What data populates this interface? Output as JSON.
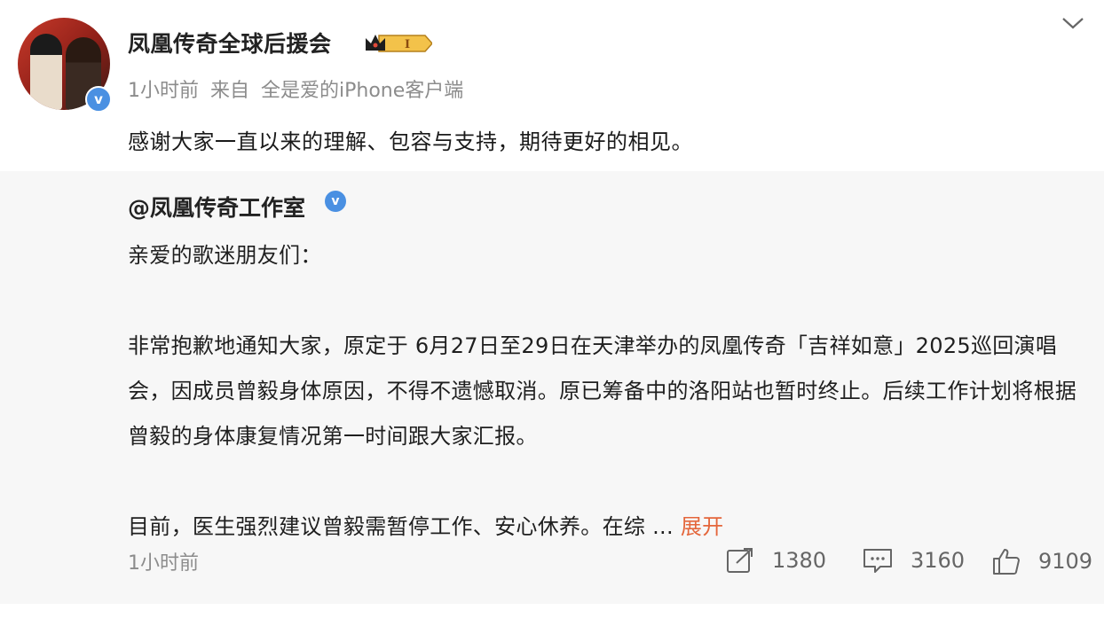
{
  "post": {
    "username": "凤凰传奇全球后援会",
    "level_badge": "I",
    "time": "1小时前",
    "source_prefix": "来自",
    "source": "全是爱的iPhone客户端",
    "content": "感谢大家一直以来的理解、包容与支持，期待更好的相见。"
  },
  "repost": {
    "username": "@凤凰传奇工作室",
    "paragraphs": [
      "亲爱的歌迷朋友们：",
      "",
      "非常抱歉地通知大家，原定于 6月27日至29日在天津举办的凤凰传奇「吉祥如意」2025巡回演唱会，因成员曾毅身体原因，不得不遗憾取消。原已筹备中的洛阳站也暂时终止。后续工作计划将根据曾毅的身体康复情况第一时间跟大家汇报。",
      ""
    ],
    "last_line": "目前，医生强烈建议曾毅需暂停工作、安心休养。在综",
    "ellipsis": " ... ",
    "expand_label": "展开",
    "time": "1小时前",
    "reposts": "1380",
    "comments": "3160",
    "likes": "9109"
  },
  "icons": [
    "chevron-down-icon",
    "verified-icon",
    "crown-level-icon",
    "share-icon",
    "comment-icon",
    "like-icon"
  ],
  "colors": {
    "accent": "#e4663b",
    "verified": "#4a90e2",
    "gray_text": "#8c8c8c",
    "repost_bg": "#f7f7f7"
  }
}
